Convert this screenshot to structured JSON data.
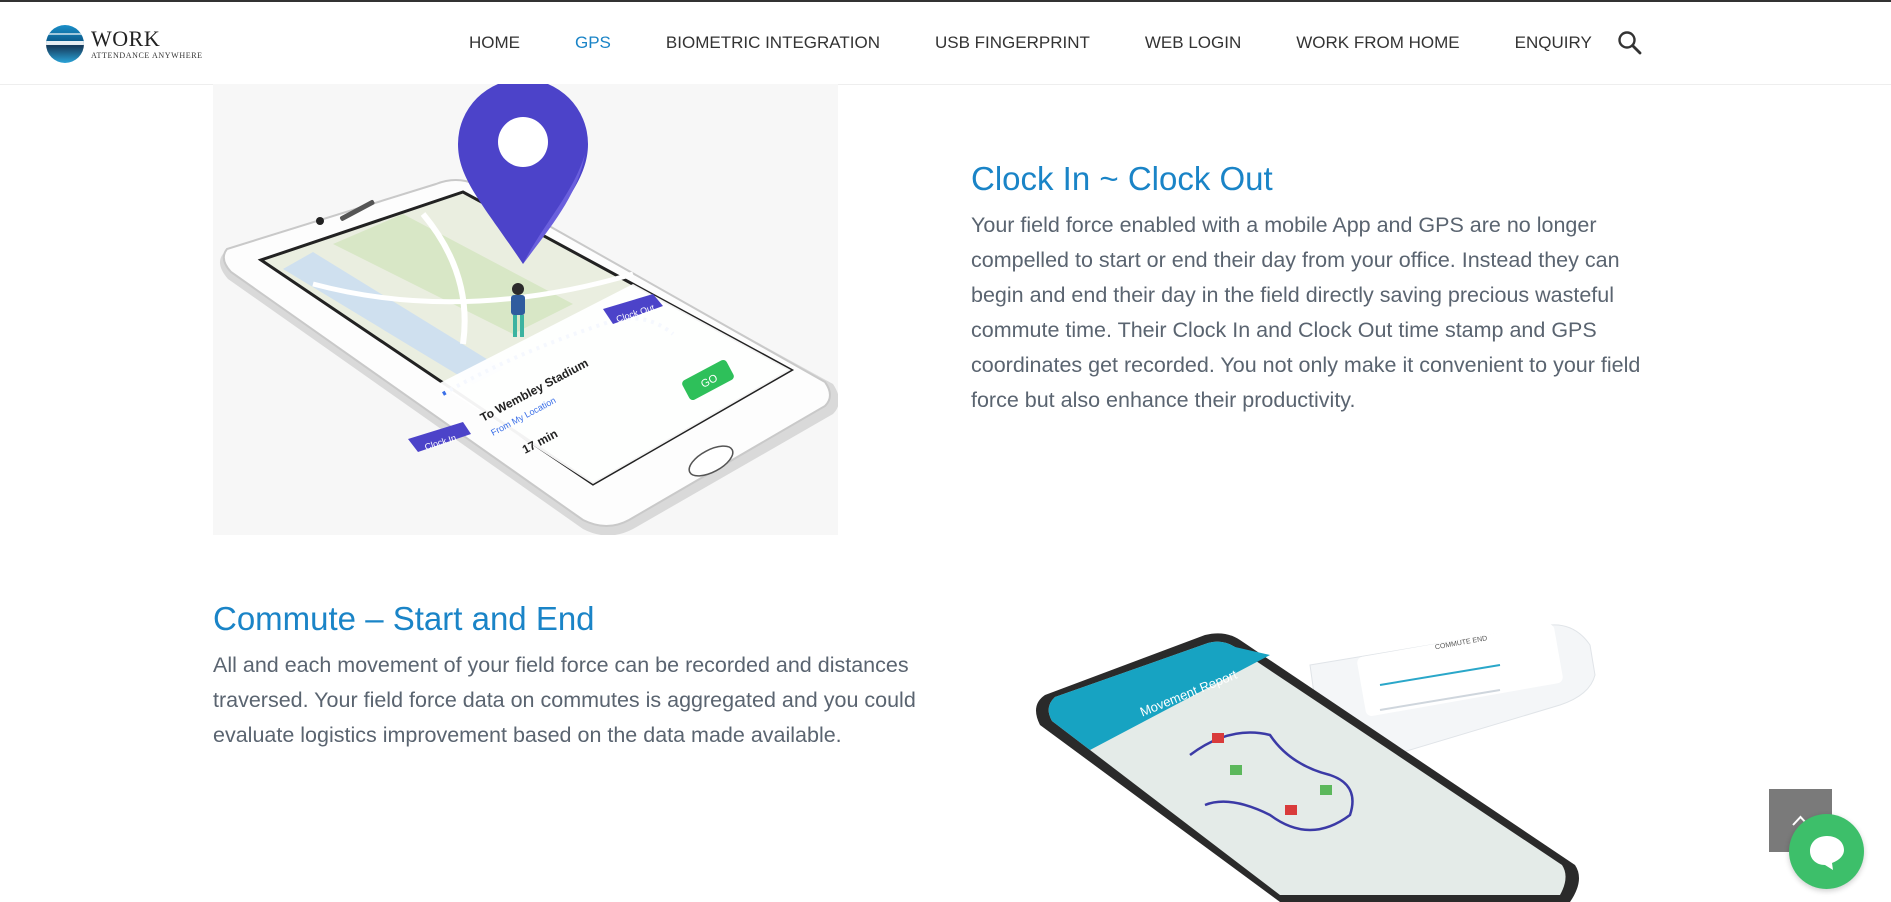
{
  "logo": {
    "wordmark": "WORK",
    "tagline": "ATTENDANCE ANYWHERE"
  },
  "nav": {
    "items": [
      {
        "label": "HOME",
        "active": false
      },
      {
        "label": "GPS",
        "active": true
      },
      {
        "label": "BIOMETRIC INTEGRATION",
        "active": false
      },
      {
        "label": "USB FINGERPRINT",
        "active": false
      },
      {
        "label": "WEB LOGIN",
        "active": false
      },
      {
        "label": "WORK FROM HOME",
        "active": false
      },
      {
        "label": "ENQUIRY",
        "active": false
      }
    ],
    "search_icon": "search-icon"
  },
  "section1": {
    "title": "Clock In ~ Clock Out",
    "body": "Your field force enabled with a mobile App and GPS are no longer compelled to start or end their day from your office. Instead they can begin and end their day in the field directly saving precious wasteful commute time. Their Clock In and Clock Out time stamp and GPS coordinates get recorded. You not only make it convenient to your field force but also enhance their productivity.",
    "illustration": {
      "clock_in_tag": "Clock In",
      "clock_out_tag": "Clock Out",
      "destination": "To Wembley Stadium",
      "from": "From My Location",
      "duration": "17 min",
      "go_label": "GO"
    }
  },
  "section2": {
    "title": "Commute – Start and End",
    "body": "All and each movement of your field force can be recorded and distances traversed. Your field force data on commutes is aggregated and you could evaluate logistics improvement based on the data made available.",
    "illustration": {
      "header": "Movement Report",
      "card_title": "COMMUTE END"
    }
  },
  "widgets": {
    "back_to_top_icon": "chevron-up-icon",
    "chat_icon": "chat-icon"
  },
  "colors": {
    "accent": "#1a84c7",
    "body_text": "#5a6470",
    "nav_text": "#333333",
    "chat": "#3dbf6a",
    "pin": "#4c43c9"
  }
}
